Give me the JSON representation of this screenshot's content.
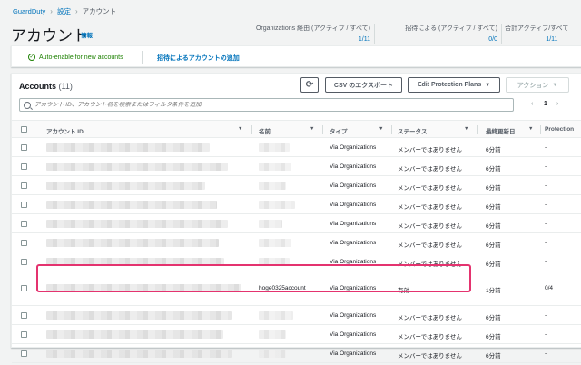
{
  "breadcrumb": {
    "items": [
      "GuardDuty",
      "設定",
      "アカウント"
    ],
    "sep": "›"
  },
  "header": {
    "title": "アカウント",
    "info": "情報"
  },
  "stats": [
    {
      "label": "Organizations 経由 (アクティブ / すべて)",
      "value": "1/11"
    },
    {
      "label": "招待による (アクティブ / すべて)",
      "value": "0/0"
    },
    {
      "label": "合計アクティブ/すべて",
      "value": "1/11"
    }
  ],
  "panel": {
    "auto_enable": "Auto-enable for new accounts",
    "check_icon": "✓",
    "add_accounts": "招待によるアカウントの追加"
  },
  "accounts": {
    "title": "Accounts",
    "count": "(11)",
    "refresh_icon": "⟳",
    "csv_label": "CSV のエクスポート",
    "protection_label": "Edit Protection Plans",
    "actions_label": "アクション",
    "caret": "▼",
    "search_placeholder": "アカウント ID、アカウント名を検索またはフィルタ条件を追加",
    "page_prev": "‹",
    "page_num": "1",
    "page_next": "›"
  },
  "table": {
    "columns": [
      "アカウント ID",
      "名前",
      "タイプ",
      "ステータス",
      "最終更新日",
      "Protection"
    ],
    "sort_icon": "▼",
    "rows": [
      {
        "name": "",
        "type": "Via Organizations",
        "status": "メンバーではありません",
        "updated": "6分前",
        "protection": "-"
      },
      {
        "name": "",
        "type": "Via Organizations",
        "status": "メンバーではありません",
        "updated": "6分前",
        "protection": "-"
      },
      {
        "name": "",
        "type": "Via Organizations",
        "status": "メンバーではありません",
        "updated": "6分前",
        "protection": "-"
      },
      {
        "name": "",
        "type": "Via Organizations",
        "status": "メンバーではありません",
        "updated": "6分前",
        "protection": "-"
      },
      {
        "name": "",
        "type": "Via Organizations",
        "status": "メンバーではありません",
        "updated": "6分前",
        "protection": "-"
      },
      {
        "name": "",
        "type": "Via Organizations",
        "status": "メンバーではありません",
        "updated": "6分前",
        "protection": "-"
      },
      {
        "name": "",
        "type": "Via Organizations",
        "status": "メンバーではありません",
        "updated": "6分前",
        "protection": "-"
      },
      {
        "name": "hoge0325account",
        "type": "Via Organizations",
        "status": "有効",
        "updated": "1分前",
        "protection": "0/4"
      },
      {
        "name": "",
        "type": "Via Organizations",
        "status": "メンバーではありません",
        "updated": "6分前",
        "protection": "-"
      },
      {
        "name": "",
        "type": "Via Organizations",
        "status": "メンバーではありません",
        "updated": "6分前",
        "protection": "-"
      },
      {
        "name": "",
        "type": "Via Organizations",
        "status": "メンバーではありません",
        "updated": "6分前",
        "protection": "-"
      }
    ]
  },
  "colors": {
    "accent": "#0073bb",
    "success": "#1d8102",
    "highlight": "#e4336f"
  }
}
